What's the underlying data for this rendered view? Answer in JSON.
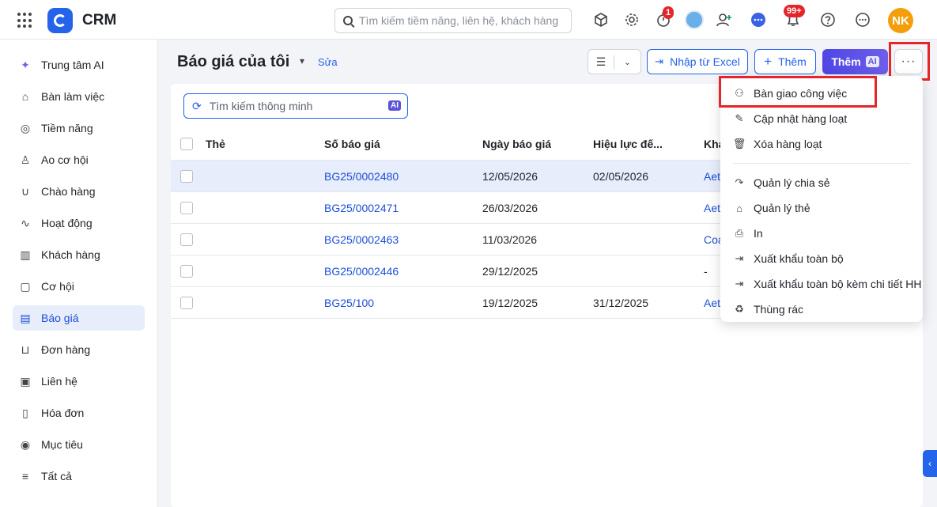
{
  "app": {
    "title": "CRM"
  },
  "top_search": {
    "placeholder": "Tìm kiếm tiềm năng, liên hệ, khách hàng"
  },
  "top_icons": {
    "timer_badge": "1",
    "notification_badge": "99+",
    "user_initials": "NK"
  },
  "sidebar": {
    "items": [
      {
        "label": "Trung tâm AI",
        "icon": "sparkle-icon"
      },
      {
        "label": "Bàn làm việc",
        "icon": "home-icon"
      },
      {
        "label": "Tiềm năng",
        "icon": "lead-icon"
      },
      {
        "label": "Ao cơ hội",
        "icon": "pool-icon"
      },
      {
        "label": "Chào hàng",
        "icon": "magnet-icon"
      },
      {
        "label": "Hoạt động",
        "icon": "activity-icon"
      },
      {
        "label": "Khách hàng",
        "icon": "building-icon"
      },
      {
        "label": "Cơ hội",
        "icon": "opportunity-icon"
      },
      {
        "label": "Báo giá",
        "icon": "quote-icon"
      },
      {
        "label": "Đơn hàng",
        "icon": "cart-icon"
      },
      {
        "label": "Liên hệ",
        "icon": "contact-icon"
      },
      {
        "label": "Hóa đơn",
        "icon": "invoice-icon"
      },
      {
        "label": "Mục tiêu",
        "icon": "target-icon"
      },
      {
        "label": "Tất cả",
        "icon": "menu-icon"
      }
    ],
    "active_index": 8
  },
  "header": {
    "title": "Báo giá của tôi",
    "edit_label": "Sửa",
    "import_label": "Nhập từ Excel",
    "add_label": "Thêm",
    "add_ai_label": "Thêm",
    "ai_chip": "AI",
    "more_label": "···"
  },
  "smart_search": {
    "placeholder": "Tìm kiếm thông minh",
    "ai_chip": "AI"
  },
  "table": {
    "columns": [
      "Thẻ",
      "Số báo giá",
      "Ngày báo giá",
      "Hiệu lực đế...",
      "Kha"
    ],
    "rows": [
      {
        "tag": "",
        "number": "BG25/0002480",
        "date": "12/05/2026",
        "valid_until": "02/05/2026",
        "customer": "Aet"
      },
      {
        "tag": "",
        "number": "BG25/0002471",
        "date": "26/03/2026",
        "valid_until": "",
        "customer": "Aet"
      },
      {
        "tag": "",
        "number": "BG25/0002463",
        "date": "11/03/2026",
        "valid_until": "",
        "customer": "Coa"
      },
      {
        "tag": "",
        "number": "BG25/0002446",
        "date": "29/12/2025",
        "valid_until": "",
        "customer": "-"
      },
      {
        "tag": "",
        "number": "BG25/100",
        "date": "19/12/2025",
        "valid_until": "31/12/2025",
        "customer": "Aet"
      }
    ]
  },
  "dropdown": {
    "items": [
      {
        "label": "Bàn giao công việc",
        "icon": "handover-icon"
      },
      {
        "label": "Cập nhật hàng loạt",
        "icon": "pencil-icon"
      },
      {
        "label": "Xóa hàng loạt",
        "icon": "trash-icon"
      },
      {
        "label": "Quản lý chia sẻ",
        "icon": "share-icon"
      },
      {
        "label": "Quản lý thẻ",
        "icon": "tag-icon"
      },
      {
        "label": "In",
        "icon": "printer-icon"
      },
      {
        "label": "Xuất khẩu toàn bộ",
        "icon": "export-icon"
      },
      {
        "label": "Xuất khẩu toàn bộ kèm chi tiết HH",
        "icon": "export-detail-icon"
      },
      {
        "label": "Thùng rác",
        "icon": "recycle-bin-icon"
      }
    ]
  },
  "colors": {
    "accent": "#2563eb",
    "highlight": "#e5252a",
    "active_bg": "#e7edfb"
  }
}
